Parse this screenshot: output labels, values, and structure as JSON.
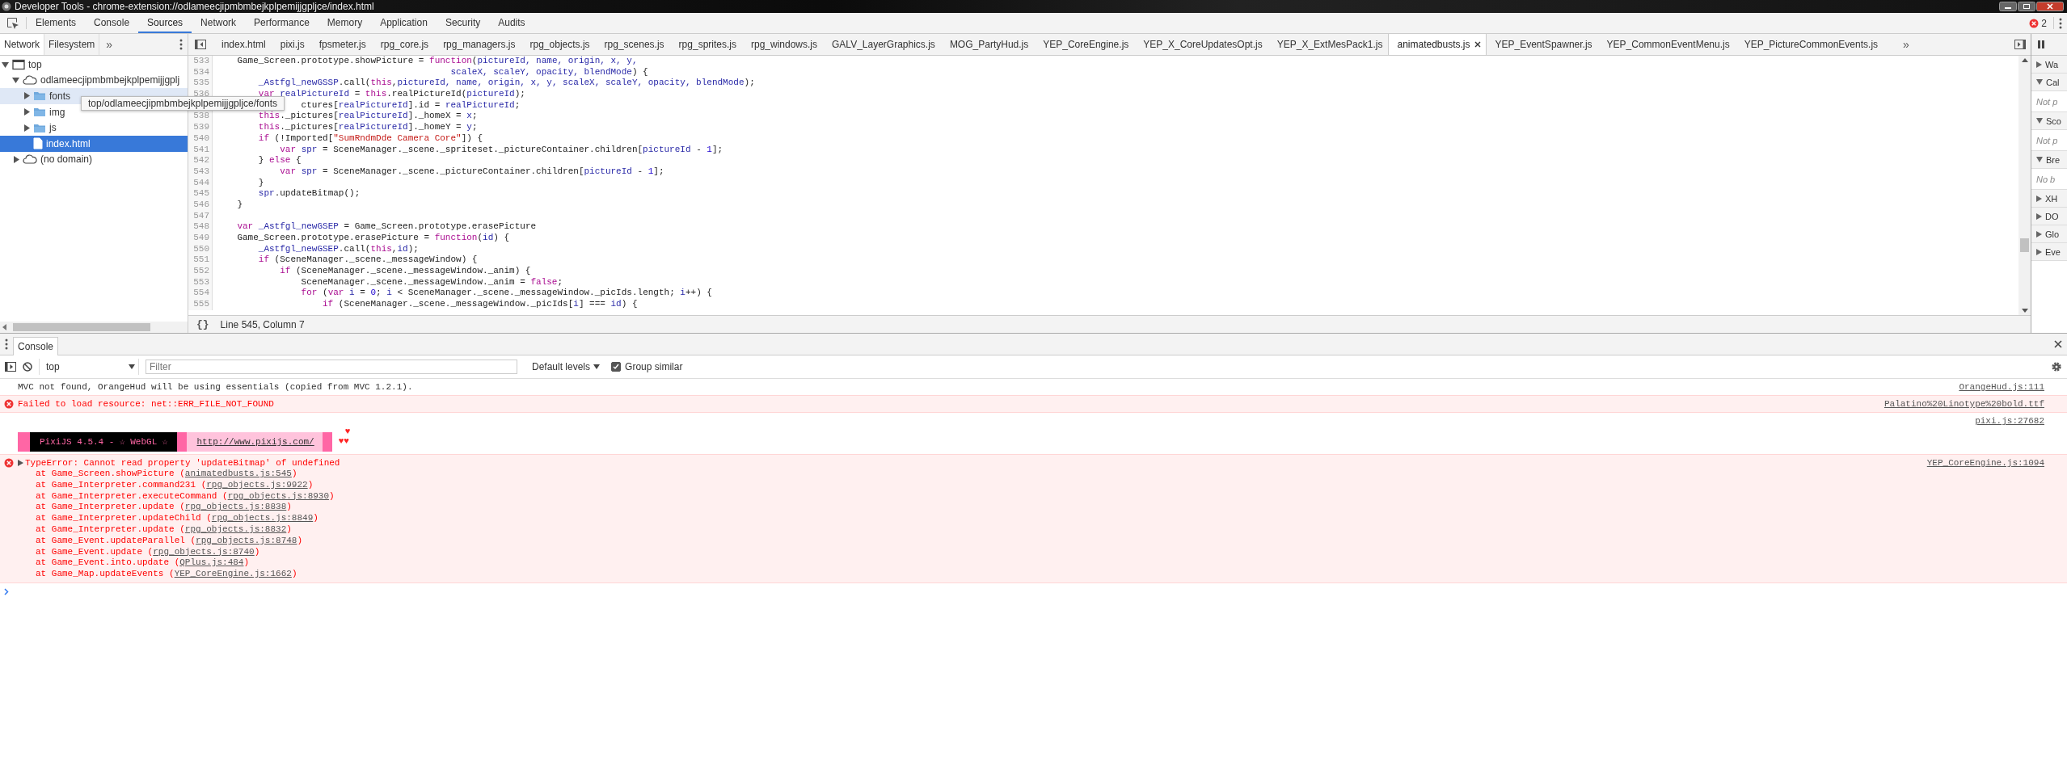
{
  "window": {
    "title": "Developer Tools - chrome-extension://odlameecjipmbmbejkplpemijjgpljce/index.html"
  },
  "main_tabs": [
    {
      "label": "Elements",
      "selected": false
    },
    {
      "label": "Console",
      "selected": false
    },
    {
      "label": "Sources",
      "selected": true
    },
    {
      "label": "Network",
      "selected": false
    },
    {
      "label": "Performance",
      "selected": false
    },
    {
      "label": "Memory",
      "selected": false
    },
    {
      "label": "Application",
      "selected": false
    },
    {
      "label": "Security",
      "selected": false
    },
    {
      "label": "Audits",
      "selected": false
    }
  ],
  "error_count": "2",
  "navigator": {
    "tabs": [
      {
        "label": "Network",
        "selected": true
      },
      {
        "label": "Filesystem",
        "selected": false
      }
    ],
    "more": "»",
    "tree": [
      {
        "label": "top",
        "kind": "frame",
        "expanded": true,
        "selected": false,
        "hovered": false,
        "children": [
          {
            "label": "odlameecjipmbmbejkplpemijjgplj",
            "kind": "domain",
            "expanded": true,
            "selected": false,
            "hovered": false,
            "children": [
              {
                "label": "fonts",
                "kind": "folder",
                "expanded": false,
                "selected": false,
                "hovered": true
              },
              {
                "label": "img",
                "kind": "folder",
                "expanded": false,
                "selected": false,
                "hovered": false
              },
              {
                "label": "js",
                "kind": "folder",
                "expanded": false,
                "selected": false,
                "hovered": false
              },
              {
                "label": "index.html",
                "kind": "file",
                "selected": true,
                "hovered": false
              }
            ]
          },
          {
            "label": "(no domain)",
            "kind": "domain",
            "expanded": false,
            "selected": false,
            "hovered": false
          }
        ]
      }
    ],
    "tooltip": "top/odlameecjipmbmbejkplpemijjgpljce/fonts"
  },
  "editor": {
    "tabs": [
      {
        "label": "index.html",
        "selected": false
      },
      {
        "label": "pixi.js",
        "selected": false
      },
      {
        "label": "fpsmeter.js",
        "selected": false
      },
      {
        "label": "rpg_core.js",
        "selected": false
      },
      {
        "label": "rpg_managers.js",
        "selected": false
      },
      {
        "label": "rpg_objects.js",
        "selected": false
      },
      {
        "label": "rpg_scenes.js",
        "selected": false
      },
      {
        "label": "rpg_sprites.js",
        "selected": false
      },
      {
        "label": "rpg_windows.js",
        "selected": false
      },
      {
        "label": "GALV_LayerGraphics.js",
        "selected": false
      },
      {
        "label": "MOG_PartyHud.js",
        "selected": false
      },
      {
        "label": "YEP_CoreEngine.js",
        "selected": false
      },
      {
        "label": "YEP_X_CoreUpdatesOpt.js",
        "selected": false
      },
      {
        "label": "YEP_X_ExtMesPack1.js",
        "selected": false
      },
      {
        "label": "animatedbusts.js",
        "selected": true
      },
      {
        "label": "YEP_EventSpawner.js",
        "selected": false
      },
      {
        "label": "YEP_CommonEventMenu.js",
        "selected": false
      },
      {
        "label": "YEP_PictureCommonEvents.js",
        "selected": false
      }
    ],
    "more": "»",
    "lines": [
      {
        "n": "533",
        "tokens": [
          {
            "kind": "plain",
            "text": "    Game_Screen.prototype.showPicture = "
          },
          {
            "kind": "keyword",
            "text": "function"
          },
          {
            "kind": "plain",
            "text": "("
          },
          {
            "kind": "variable",
            "text": "pictureId, name, origin, x, y,"
          }
        ]
      },
      {
        "n": "534",
        "tokens": [
          {
            "kind": "variable",
            "text": "                                            scaleX, scaleY, opacity, blendMode"
          },
          {
            "kind": "plain",
            "text": ") {"
          }
        ]
      },
      {
        "n": "535",
        "tokens": [
          {
            "kind": "variable",
            "text": "        _Astfgl_newGSSP"
          },
          {
            "kind": "plain",
            "text": ".call("
          },
          {
            "kind": "keyword",
            "text": "this"
          },
          {
            "kind": "plain",
            "text": ","
          },
          {
            "kind": "variable",
            "text": "pictureId, name, origin, x, y, scaleX, scaleY, opacity, blendMode"
          },
          {
            "kind": "plain",
            "text": ");"
          }
        ]
      },
      {
        "n": "536",
        "tokens": [
          {
            "kind": "keyword",
            "text": "        var"
          },
          {
            "kind": "variable",
            "text": " realPictureId"
          },
          {
            "kind": "plain",
            "text": " = "
          },
          {
            "kind": "keyword",
            "text": "this"
          },
          {
            "kind": "plain",
            "text": ".realPictureId("
          },
          {
            "kind": "variable",
            "text": "pictureId"
          },
          {
            "kind": "plain",
            "text": ");"
          }
        ]
      },
      {
        "tokens": [
          {
            "kind": "plain",
            "text": "                ctures["
          },
          {
            "kind": "variable",
            "text": "realPictureId"
          },
          {
            "kind": "plain",
            "text": "].id = "
          },
          {
            "kind": "variable",
            "text": "realPictureId"
          },
          {
            "kind": "plain",
            "text": ";"
          }
        ]
      },
      {
        "n": "538",
        "tokens": [
          {
            "kind": "keyword",
            "text": "        this"
          },
          {
            "kind": "plain",
            "text": "._pictures["
          },
          {
            "kind": "variable",
            "text": "realPictureId"
          },
          {
            "kind": "plain",
            "text": "]._homeX = "
          },
          {
            "kind": "variable",
            "text": "x"
          },
          {
            "kind": "plain",
            "text": ";"
          }
        ]
      },
      {
        "n": "539",
        "tokens": [
          {
            "kind": "keyword",
            "text": "        this"
          },
          {
            "kind": "plain",
            "text": "._pictures["
          },
          {
            "kind": "variable",
            "text": "realPictureId"
          },
          {
            "kind": "plain",
            "text": "]._homeY = "
          },
          {
            "kind": "variable",
            "text": "y"
          },
          {
            "kind": "plain",
            "text": ";"
          }
        ]
      },
      {
        "n": "540",
        "tokens": [
          {
            "kind": "keyword",
            "text": "        if"
          },
          {
            "kind": "plain",
            "text": " (!Imported["
          },
          {
            "kind": "string",
            "text": "\"SumRndmDde Camera Core\""
          },
          {
            "kind": "plain",
            "text": "]) {"
          }
        ]
      },
      {
        "n": "541",
        "tokens": [
          {
            "kind": "keyword",
            "text": "            var"
          },
          {
            "kind": "variable",
            "text": " spr"
          },
          {
            "kind": "plain",
            "text": " = SceneManager._scene._spriteset._pictureContainer.children["
          },
          {
            "kind": "variable",
            "text": "pictureId"
          },
          {
            "kind": "plain",
            "text": " - "
          },
          {
            "kind": "number",
            "text": "1"
          },
          {
            "kind": "plain",
            "text": "];"
          }
        ]
      },
      {
        "n": "542",
        "tokens": [
          {
            "kind": "plain",
            "text": "        } "
          },
          {
            "kind": "keyword",
            "text": "else"
          },
          {
            "kind": "plain",
            "text": " {"
          }
        ]
      },
      {
        "n": "543",
        "tokens": [
          {
            "kind": "keyword",
            "text": "            var"
          },
          {
            "kind": "variable",
            "text": " spr"
          },
          {
            "kind": "plain",
            "text": " = SceneManager._scene._pictureContainer.children["
          },
          {
            "kind": "variable",
            "text": "pictureId"
          },
          {
            "kind": "plain",
            "text": " - "
          },
          {
            "kind": "number",
            "text": "1"
          },
          {
            "kind": "plain",
            "text": "];"
          }
        ]
      },
      {
        "n": "544",
        "tokens": [
          {
            "kind": "plain",
            "text": "        }"
          }
        ]
      },
      {
        "n": "545",
        "tokens": [
          {
            "kind": "variable",
            "text": "        spr"
          },
          {
            "kind": "plain",
            "text": ".updateBitmap();"
          }
        ]
      },
      {
        "n": "546",
        "tokens": [
          {
            "kind": "plain",
            "text": "    }"
          }
        ]
      },
      {
        "n": "547"
      },
      {
        "n": "548",
        "tokens": [
          {
            "kind": "keyword",
            "text": "    var"
          },
          {
            "kind": "variable",
            "text": " _Astfgl_newGSEP"
          },
          {
            "kind": "plain",
            "text": " = Game_Screen.prototype.erasePicture"
          }
        ]
      },
      {
        "n": "549",
        "tokens": [
          {
            "kind": "plain",
            "text": "    Game_Screen.prototype.erasePicture = "
          },
          {
            "kind": "keyword",
            "text": "function"
          },
          {
            "kind": "plain",
            "text": "("
          },
          {
            "kind": "variable",
            "text": "id"
          },
          {
            "kind": "plain",
            "text": ") {"
          }
        ]
      },
      {
        "n": "550",
        "tokens": [
          {
            "kind": "variable",
            "text": "        _Astfgl_newGSEP"
          },
          {
            "kind": "plain",
            "text": ".call("
          },
          {
            "kind": "keyword",
            "text": "this"
          },
          {
            "kind": "plain",
            "text": ","
          },
          {
            "kind": "variable",
            "text": "id"
          },
          {
            "kind": "plain",
            "text": ");"
          }
        ]
      },
      {
        "n": "551",
        "tokens": [
          {
            "kind": "keyword",
            "text": "        if"
          },
          {
            "kind": "plain",
            "text": " (SceneManager._scene._messageWindow) {"
          }
        ]
      },
      {
        "n": "552",
        "tokens": [
          {
            "kind": "keyword",
            "text": "            if"
          },
          {
            "kind": "plain",
            "text": " (SceneManager._scene._messageWindow._anim) {"
          }
        ]
      },
      {
        "n": "553",
        "tokens": [
          {
            "kind": "plain",
            "text": "                SceneManager._scene._messageWindow._anim = "
          },
          {
            "kind": "keyword",
            "text": "false"
          },
          {
            "kind": "plain",
            "text": ";"
          }
        ]
      },
      {
        "n": "554",
        "tokens": [
          {
            "kind": "keyword",
            "text": "                for"
          },
          {
            "kind": "plain",
            "text": " ("
          },
          {
            "kind": "keyword",
            "text": "var"
          },
          {
            "kind": "variable",
            "text": " i"
          },
          {
            "kind": "plain",
            "text": " = "
          },
          {
            "kind": "number",
            "text": "0"
          },
          {
            "kind": "plain",
            "text": "; "
          },
          {
            "kind": "variable",
            "text": "i"
          },
          {
            "kind": "plain",
            "text": " < SceneManager._scene._messageWindow._picIds.length; "
          },
          {
            "kind": "variable",
            "text": "i"
          },
          {
            "kind": "plain",
            "text": "++) {"
          }
        ]
      },
      {
        "n": "555",
        "tokens": [
          {
            "kind": "keyword",
            "text": "                    if"
          },
          {
            "kind": "plain",
            "text": " (SceneManager._scene._messageWindow._picIds["
          },
          {
            "kind": "variable",
            "text": "i"
          },
          {
            "kind": "plain",
            "text": "] === "
          },
          {
            "kind": "variable",
            "text": "id"
          },
          {
            "kind": "plain",
            "text": ") {"
          }
        ]
      }
    ],
    "status": {
      "pretty_print": "{}",
      "position": "Line 545, Column 7"
    }
  },
  "debugger_sidebar": {
    "sections": [
      {
        "title": "Wa",
        "expanded": false
      },
      {
        "title": "Cal",
        "expanded": true,
        "message": "Not p"
      },
      {
        "title": "Sco",
        "expanded": true,
        "message": "Not p"
      },
      {
        "title": "Bre",
        "expanded": true,
        "message": "No b"
      },
      {
        "title": "XH",
        "expanded": false
      },
      {
        "title": "DO",
        "expanded": false
      },
      {
        "title": "Glo",
        "expanded": false
      },
      {
        "title": "Eve",
        "expanded": false
      }
    ]
  },
  "console": {
    "drawer_tab": {
      "label": "Console",
      "selected": true
    },
    "context": "top",
    "filter_placeholder": "Filter",
    "levels": "Default levels",
    "group_similar": {
      "label": "Group similar",
      "checked": true
    },
    "messages": [
      {
        "kind": "info",
        "text": "MVC not found, OrangeHud will be using essentials (copied from MVC 1.2.1).",
        "source": "OrangeHud.js:111"
      },
      {
        "kind": "error",
        "text": "Failed to load resource: net::ERR_FILE_NOT_FOUND",
        "source": "Palatino%20Linotype%20bold.ttf"
      },
      {
        "kind": "banner",
        "source": "pixi.js:27682",
        "segments": [
          {
            "kind": "block"
          },
          {
            "kind": "label",
            "text": "PixiJS 4.5.4 - ☆ WebGL ☆"
          },
          {
            "kind": "block"
          },
          {
            "kind": "link",
            "text": "http://www.pixijs.com/"
          },
          {
            "kind": "block"
          }
        ],
        "hearts": [
          "♥",
          "♥♥"
        ]
      },
      {
        "kind": "exception",
        "text": "TypeError: Cannot read property 'updateBitmap' of undefined",
        "expanded": false,
        "source": "YEP_CoreEngine.js:1094",
        "stack": [
          {
            "text": "at Game_Screen.showPicture (",
            "link": "animatedbusts.js:545",
            "end": ")"
          },
          {
            "text": "at Game_Interpreter.command231 (",
            "link": "rpg_objects.js:9922",
            "end": ")"
          },
          {
            "text": "at Game_Interpreter.executeCommand (",
            "link": "rpg_objects.js:8930",
            "end": ")"
          },
          {
            "text": "at Game_Interpreter.update (",
            "link": "rpg_objects.js:8838",
            "end": ")"
          },
          {
            "text": "at Game_Interpreter.updateChild (",
            "link": "rpg_objects.js:8849",
            "end": ")"
          },
          {
            "text": "at Game_Interpreter.update (",
            "link": "rpg_objects.js:8832",
            "end": ")"
          },
          {
            "text": "at Game_Event.updateParallel (",
            "link": "rpg_objects.js:8748",
            "end": ")"
          },
          {
            "text": "at Game_Event.update (",
            "link": "rpg_objects.js:8740",
            "end": ")"
          },
          {
            "text": "at Game_Event.into.update (",
            "link": "QPlus.js:484",
            "end": ")"
          },
          {
            "text": "at Game_Map.updateEvents (",
            "link": "YEP_CoreEngine.js:1662",
            "end": ")"
          }
        ]
      }
    ]
  }
}
